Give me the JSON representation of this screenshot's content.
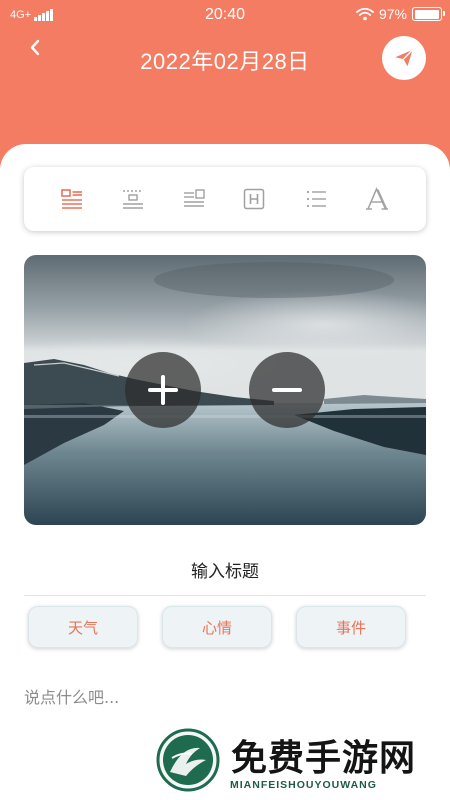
{
  "status_bar": {
    "network": "4G+",
    "time": "20:40",
    "battery_text": "97%",
    "battery_level": 0.97
  },
  "header": {
    "date_title": "2022年02月28日"
  },
  "toolbar": {
    "tools": [
      "layout-image-top",
      "layout-image-middle",
      "layout-image-right",
      "heading",
      "list",
      "font"
    ],
    "active_tool": "layout-image-top",
    "active_color": "#e9735a",
    "inactive_color": "#9b9b9b"
  },
  "photo": {
    "zoom_in_icon": "plus-icon",
    "zoom_out_icon": "minus-icon"
  },
  "editor": {
    "title_placeholder": "输入标题",
    "body_placeholder": "说点什么吧..."
  },
  "tags": {
    "weather": "天气",
    "mood": "心情",
    "event": "事件"
  },
  "watermark": {
    "title": "免费手游网",
    "subtitle": "MIANFEISHOUYOUWANG"
  },
  "colors": {
    "accent": "#f47c62",
    "tag_text": "#e9735a"
  }
}
